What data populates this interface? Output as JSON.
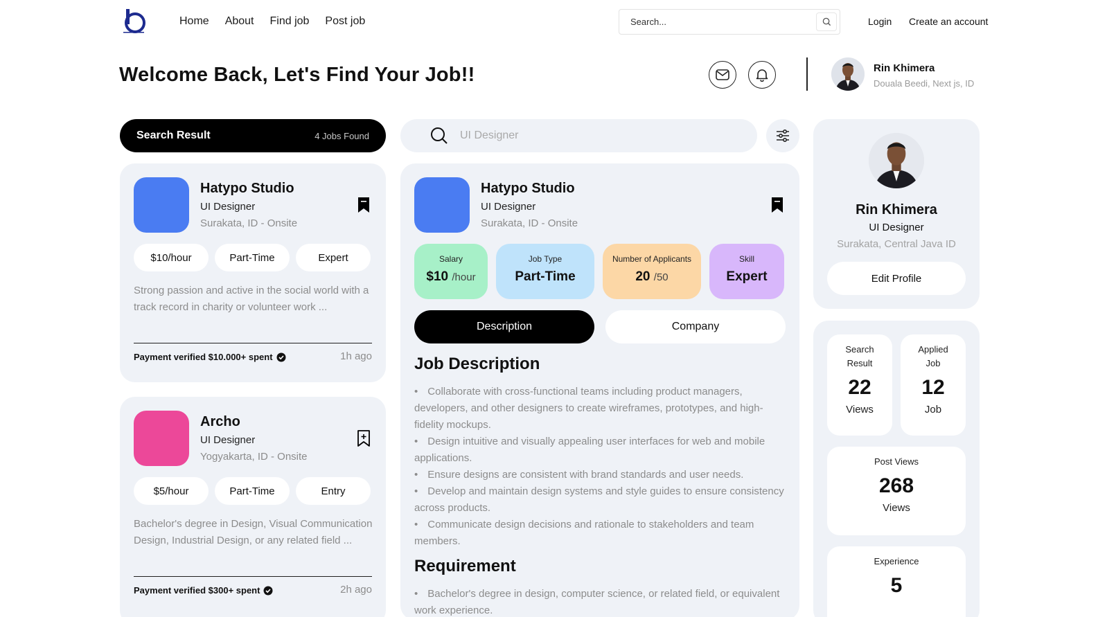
{
  "nav": {
    "links": [
      "Home",
      "About",
      "Find job",
      "Post job"
    ],
    "search_placeholder": "Search...",
    "login": "Login",
    "create_account": "Create an account"
  },
  "header": {
    "welcome": "Welcome Back, Let's Find Your Job!!",
    "user_name": "Rin Khimera",
    "user_location": "Douala Beedi, Next js, ID"
  },
  "left": {
    "search_result_label": "Search Result",
    "jobs_found": "4 Jobs Found",
    "jobs": [
      {
        "company": "Hatypo Studio",
        "role": "UI Designer",
        "location": "Surakata, ID - Onsite",
        "logo_color": "#4a7cf2",
        "bookmarked": true,
        "chips": [
          "$10/hour",
          "Part-Time",
          "Expert"
        ],
        "description": "Strong passion and active in the social world with a track record in charity or volunteer work ...",
        "payment": "Payment verified $10.000+ spent",
        "time": "1h ago"
      },
      {
        "company": "Archo",
        "role": "UI Designer",
        "location": "Yogyakarta, ID - Onsite",
        "logo_color": "#ec4899",
        "bookmarked": false,
        "chips": [
          "$5/hour",
          "Part-Time",
          "Entry"
        ],
        "description": "Bachelor's degree in Design, Visual Communication Design, Industrial Design, or any related field ...",
        "payment": "Payment verified $300+ spent",
        "time": "2h ago"
      }
    ]
  },
  "middle": {
    "search_value": "UI Designer",
    "company": "Hatypo Studio",
    "role": "UI Designer",
    "location": "Surakata, ID - Onsite",
    "logo_color": "#4a7cf2",
    "stats": [
      {
        "label": "Salary",
        "value": "$10",
        "suffix": "/hour",
        "color": "#a7f0c8"
      },
      {
        "label": "Job Type",
        "value": "Part-Time",
        "suffix": "",
        "color": "#bfe3fb"
      },
      {
        "label": "Number of Applicants",
        "value": "20",
        "suffix": "/50",
        "color": "#fcd7a6"
      },
      {
        "label": "Skill",
        "value": "Expert",
        "suffix": "",
        "color": "#d8b7fb"
      }
    ],
    "tabs": [
      "Description",
      "Company"
    ],
    "description_title": "Job Description",
    "description_items": [
      "Collaborate with cross-functional teams including product managers, developers, and other designers to create wireframes, prototypes, and high-fidelity mockups.",
      "Design intuitive and visually appealing user interfaces for web and mobile applications.",
      "Ensure designs are consistent with brand standards and user needs.",
      "Develop and maintain design systems and style guides to ensure consistency across products.",
      "Communicate design decisions and rationale to stakeholders and team members."
    ],
    "requirement_title": "Requirement",
    "requirement_items": [
      "Bachelor's degree in design, computer science, or related field, or equivalent work experience."
    ]
  },
  "right": {
    "name": "Rin Khimera",
    "role": "UI Designer",
    "location": "Surakata, Central Java ID",
    "edit_profile": "Edit Profile",
    "search_result": {
      "label": "Search Result",
      "value": "22",
      "unit": "Views"
    },
    "applied_job": {
      "label": "Applied Job",
      "value": "12",
      "unit": "Job"
    },
    "post_views": {
      "label": "Post Views",
      "value": "268",
      "unit": "Views"
    },
    "experience": {
      "label": "Experience",
      "value": "5"
    }
  }
}
